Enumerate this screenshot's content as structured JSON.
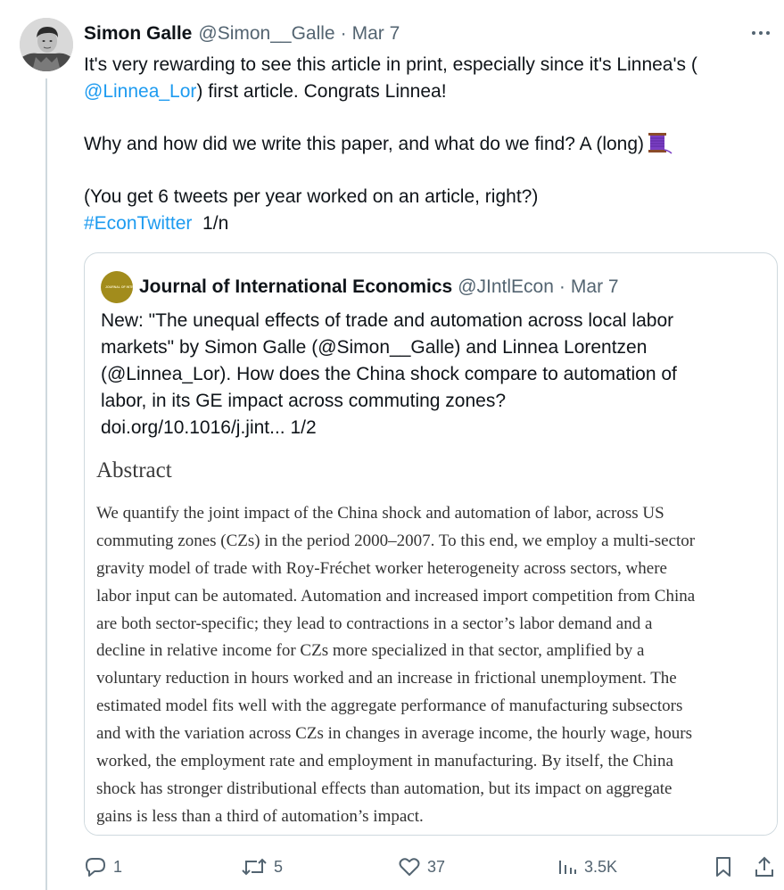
{
  "tweet": {
    "author": {
      "name": "Simon Galle",
      "handle": "@Simon__Galle"
    },
    "separator": "·",
    "date": "Mar 7",
    "more_label": "···",
    "text": {
      "line1": "It's very rewarding to see this article in print, especially since it's Linnea's (",
      "line2_mention": "@Linnea_Lor",
      "line2_rest": ") first article. Congrats Linnea!",
      "line3": "Why and how did we write this paper, and what do we find? A (long)",
      "line4": "(You get 6 tweets per year worked on an article, right?)",
      "line5_hashtag": "#EconTwitter",
      "line5_rest": "  1/n"
    },
    "thread_emoji": "thread-spool-emoji"
  },
  "quote": {
    "author": {
      "name": "Journal of International Economics",
      "handle": "@JIntlEcon",
      "avatar_text": "JOURNAL OF INTERNATIONAL ECONOMICS"
    },
    "separator": "·",
    "date": "Mar 7",
    "text_lines": [
      "New: \"The unequal effects of trade and automation across local labor",
      "markets\" by Simon Galle (@Simon__Galle) and Linnea Lorentzen",
      "(@Linnea_Lor). How does the China shock compare to automation of",
      "labor, in its GE impact across commuting zones?",
      "doi.org/10.1016/j.jint... 1/2"
    ],
    "abstract": {
      "title": "Abstract",
      "lines": [
        "We quantify the joint impact of the China shock and automation of labor, across US",
        "commuting zones (CZs) in the period 2000–2007. To this end, we employ a multi-sector",
        "gravity model of trade with Roy-Fréchet worker heterogeneity across sectors, where",
        "labor input can be automated. Automation and increased import competition from China",
        "are both sector-specific; they lead to contractions in a sector’s labor demand and a",
        "decline in relative income for CZs more specialized in that sector, amplified by a",
        "voluntary reduction in hours worked and an increase in frictional unemployment. The",
        "estimated model fits well with the aggregate performance of manufacturing subsectors",
        "and with the variation across CZs in changes in average income, the hourly wage, hours",
        "worked, the employment rate and employment in manufacturing. By itself, the China",
        "shock has stronger distributional effects than automation, but its impact on aggregate",
        "gains is less than a third of automation’s impact."
      ]
    }
  },
  "actions": {
    "replies": "1",
    "retweets": "5",
    "likes": "37",
    "views": "3.5K"
  },
  "colors": {
    "link": "#1d9bf0",
    "muted": "#536471",
    "text": "#0f1419",
    "border": "#cfd9de",
    "thread_spool": "#7b3fc4"
  }
}
